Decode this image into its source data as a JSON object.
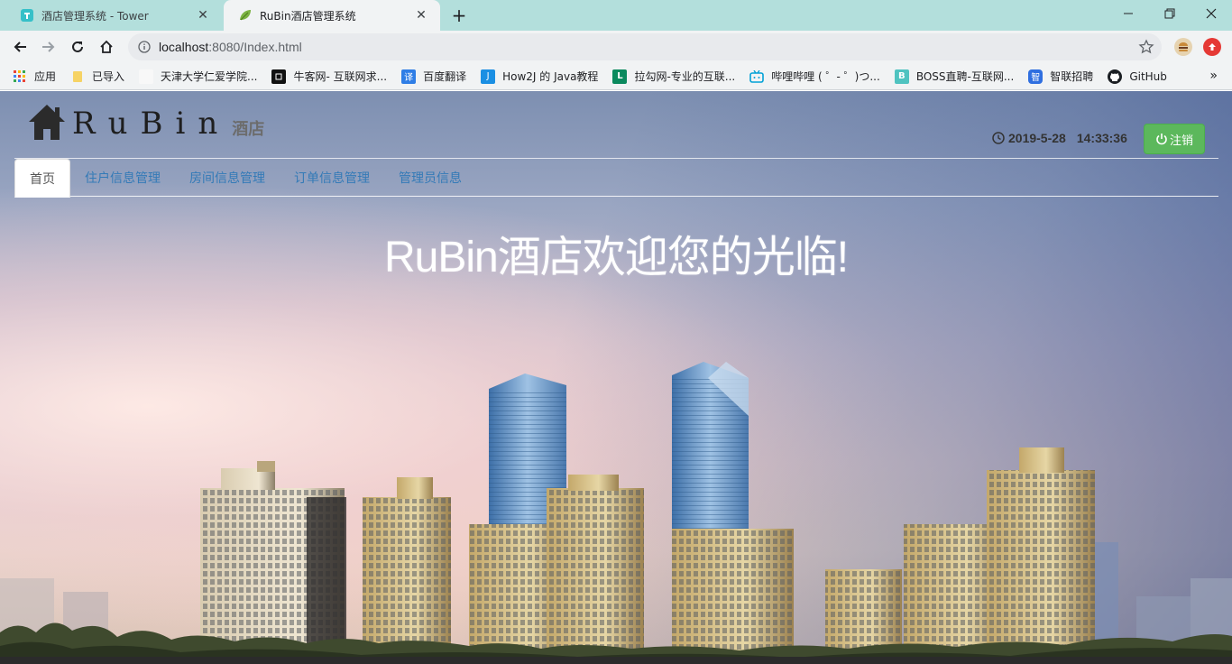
{
  "browser": {
    "tabs": [
      {
        "title": "酒店管理系统 - Tower",
        "active": false,
        "icon": "tower-icon"
      },
      {
        "title": "RuBin酒店管理系统",
        "active": true,
        "icon": "leaf-icon"
      }
    ],
    "url_host": "localhost",
    "url_path": ":8080/Index.html",
    "bookmarks": [
      {
        "label": "应用",
        "icon": "apps-grid-icon"
      },
      {
        "label": "已导入",
        "icon": "folder-icon"
      },
      {
        "label": "天津大学仁爱学院...",
        "icon": "blank-page-icon"
      },
      {
        "label": "牛客网- 互联网求...",
        "icon": "nowcoder-icon"
      },
      {
        "label": "百度翻译",
        "icon": "baidu-translate-icon"
      },
      {
        "label": "How2J 的 Java教程",
        "icon": "how2j-icon"
      },
      {
        "label": "拉勾网-专业的互联...",
        "icon": "lagou-icon"
      },
      {
        "label": "哔哩哔哩 ( ゜- ゜)つ...",
        "icon": "bilibili-icon"
      },
      {
        "label": "BOSS直聘-互联网...",
        "icon": "boss-icon"
      },
      {
        "label": "智联招聘",
        "icon": "zhaopin-icon"
      },
      {
        "label": "GitHub",
        "icon": "github-icon"
      }
    ]
  },
  "page": {
    "brand": "RuBin",
    "brand_sub": "酒店",
    "date": "2019-5-28",
    "time": "14:33:36",
    "logout_label": "注销",
    "nav": [
      {
        "label": "首页",
        "active": true
      },
      {
        "label": "住户信息管理",
        "active": false
      },
      {
        "label": "房间信息管理",
        "active": false
      },
      {
        "label": "订单信息管理",
        "active": false
      },
      {
        "label": "管理员信息",
        "active": false
      }
    ],
    "welcome": "RuBin酒店欢迎您的光临!"
  },
  "colors": {
    "tabstrip": "#b3dfdc",
    "link": "#337ab7",
    "logout_green": "#5cb85c"
  }
}
